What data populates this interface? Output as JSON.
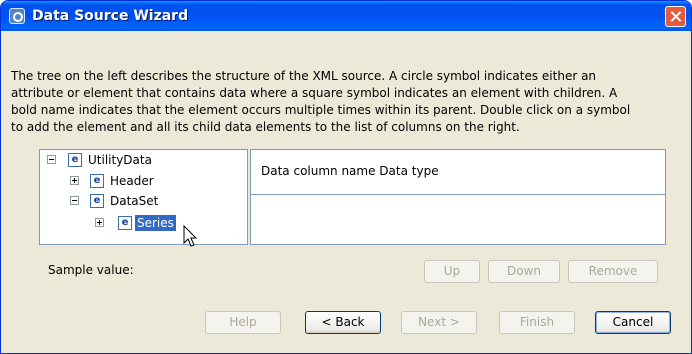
{
  "window": {
    "title": "Data Source Wizard"
  },
  "description": {
    "lines": [
      "The tree on the left describes the structure of the XML source.  A circle symbol indicates either an",
      "attribute or element that contains data where a square symbol indicates an element with children.  A",
      "bold name indicates that the element occurs multiple times within its parent.  Double click on a symbol",
      "to add the element and all its child data elements to the list of columns on the right."
    ]
  },
  "tree": {
    "element_badge": "e",
    "nodes": [
      {
        "label": "UtilityData",
        "expander": "minus",
        "depth": 0
      },
      {
        "label": "Header",
        "expander": "plus",
        "depth": 1
      },
      {
        "label": "DataSet",
        "expander": "minus",
        "depth": 1
      },
      {
        "label": "Series",
        "expander": "plus",
        "depth": 2,
        "selected": true
      }
    ]
  },
  "columns": {
    "header": "Data column name Data type"
  },
  "sample": {
    "label": "Sample value:"
  },
  "column_buttons": {
    "up": "Up",
    "down": "Down",
    "remove": "Remove"
  },
  "footer_buttons": {
    "help": "Help",
    "back": "< Back",
    "next": "Next >",
    "finish": "Finish",
    "cancel": "Cancel"
  },
  "colors": {
    "title_bar": "#0053ee",
    "dialog_bg": "#ece9d8",
    "selection": "#316ac5",
    "close_button": "#e35b3f"
  },
  "icons": [
    "app-icon",
    "close-icon",
    "element-icon",
    "expand-icon",
    "collapse-icon",
    "mouse-cursor-icon"
  ]
}
